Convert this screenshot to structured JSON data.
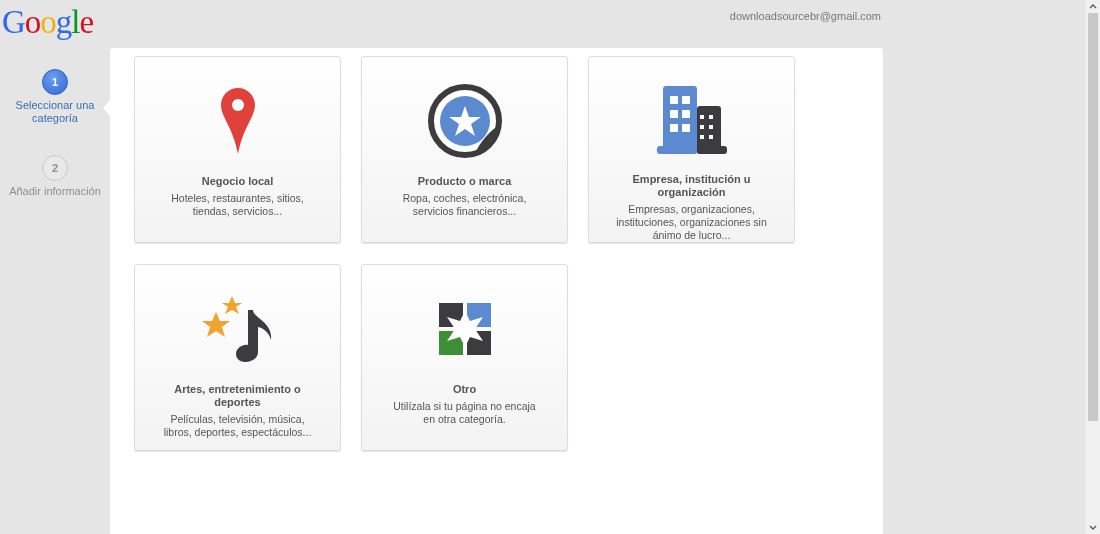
{
  "logo": "Google",
  "account": "downloadsourcebr@gmail.com",
  "steps": [
    {
      "number": "1",
      "label": "Seleccionar una categoría",
      "selected": true
    },
    {
      "number": "2",
      "label": "Añadir información",
      "selected": false
    }
  ],
  "categories": [
    {
      "kind": "pin",
      "title": "Negocio local",
      "description": "Hoteles, restaurantes, sitios, tiendas, servicios..."
    },
    {
      "kind": "sticker",
      "title": "Producto o marca",
      "description": "Ropa, coches, electrónica, servicios financieros..."
    },
    {
      "kind": "buildings",
      "title": "Empresa, institución u organización",
      "description": "Empresas, organizaciones, instituciones, organizaciones sin ánimo de lucro..."
    },
    {
      "kind": "music",
      "title": "Artes, entretenimiento o deportes",
      "description": "Películas, televisión, música, libros, deportes, espectáculos..."
    },
    {
      "kind": "tiles",
      "title": "Otro",
      "description": "Utilízala si tu página no encaja en otra categoría."
    }
  ]
}
